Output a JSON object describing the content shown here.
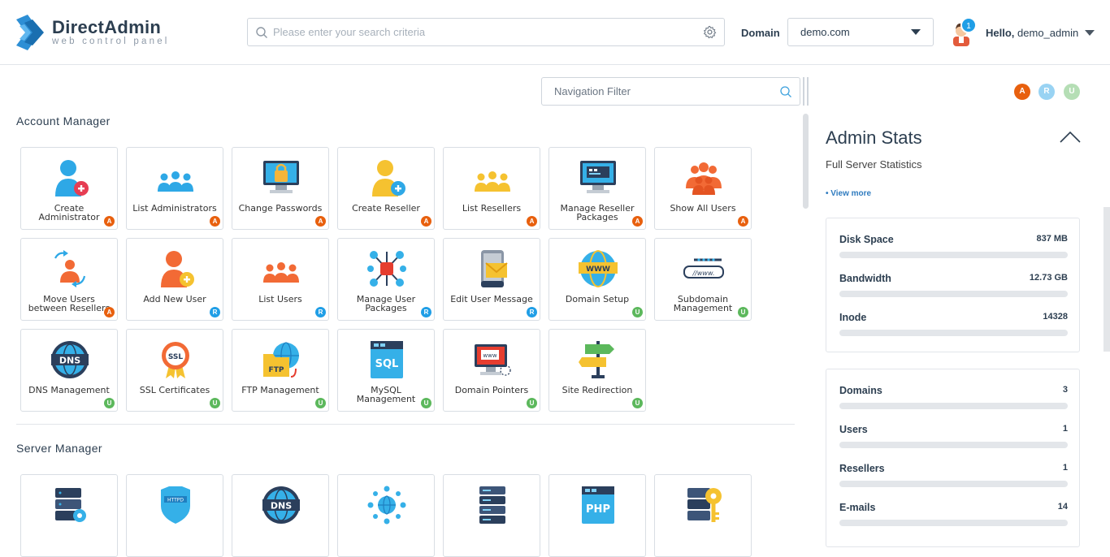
{
  "header": {
    "logo_title": "DirectAdmin",
    "logo_subtitle": "web control panel",
    "search_placeholder": "Please enter your search criteria",
    "domain_label": "Domain",
    "domain_value": "demo.com",
    "notification_count": "1",
    "hello": "Hello,",
    "username": "demo_admin"
  },
  "nav_filter_placeholder": "Navigation Filter",
  "level_colors": {
    "A": "#e8600e",
    "R": "#1f9ee6",
    "U": "#5cb85c"
  },
  "account_manager": {
    "title": "Account Manager",
    "tiles": [
      {
        "label": "Create Administrator",
        "level": "A"
      },
      {
        "label": "List Administrators",
        "level": "A"
      },
      {
        "label": "Change Passwords",
        "level": "A"
      },
      {
        "label": "Create Reseller",
        "level": "A"
      },
      {
        "label": "List Resellers",
        "level": "A"
      },
      {
        "label": "Manage Reseller Packages",
        "level": "A"
      },
      {
        "label": "Show All Users",
        "level": "A"
      },
      {
        "label": "Move Users between Resellers",
        "level": "A"
      },
      {
        "label": "Add New User",
        "level": "R"
      },
      {
        "label": "List Users",
        "level": "R"
      },
      {
        "label": "Manage User Packages",
        "level": "R"
      },
      {
        "label": "Edit User Message",
        "level": "R"
      },
      {
        "label": "Domain Setup",
        "level": "U"
      },
      {
        "label": "Subdomain Management",
        "level": "U"
      },
      {
        "label": "DNS Management",
        "level": "U"
      },
      {
        "label": "SSL Certificates",
        "level": "U"
      },
      {
        "label": "FTP Management",
        "level": "U"
      },
      {
        "label": "MySQL Management",
        "level": "U"
      },
      {
        "label": "Domain Pointers",
        "level": "U"
      },
      {
        "label": "Site Redirection",
        "level": "U"
      }
    ]
  },
  "server_manager": {
    "title": "Server Manager"
  },
  "level_keys": [
    "A",
    "R",
    "U"
  ],
  "admin_stats": {
    "title": "Admin Stats",
    "subtitle": "Full Server Statistics",
    "view_more": "• View more",
    "usage": [
      {
        "name": "Disk Space",
        "value": "837 MB"
      },
      {
        "name": "Bandwidth",
        "value": "12.73 GB"
      },
      {
        "name": "Inode",
        "value": "14328"
      }
    ],
    "counts": [
      {
        "name": "Domains",
        "value": "3"
      },
      {
        "name": "Users",
        "value": "1"
      },
      {
        "name": "Resellers",
        "value": "1"
      },
      {
        "name": "E-mails",
        "value": "14"
      }
    ]
  }
}
